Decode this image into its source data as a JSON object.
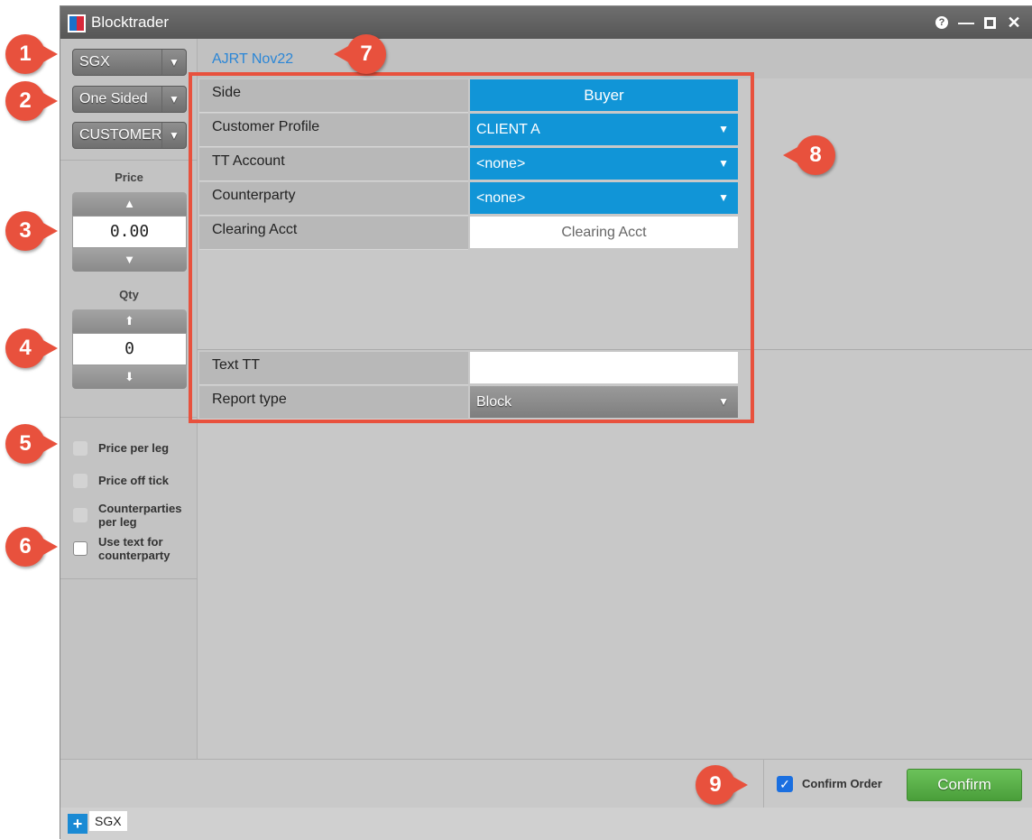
{
  "window": {
    "title": "Blocktrader",
    "controls": {
      "help": "?",
      "minimize": "—",
      "maximize": "",
      "close": "✕"
    }
  },
  "sidebar": {
    "exchange_select": "SGX",
    "side_mode_select": "One Sided",
    "account_type_select": "CUSTOMER",
    "price": {
      "label": "Price",
      "value": "0.00",
      "up": "▲",
      "down": "▼"
    },
    "qty": {
      "label": "Qty",
      "value": "0",
      "up": "🡩",
      "down": "🡫"
    },
    "options": [
      {
        "label": "Price per leg",
        "checked": false
      },
      {
        "label": "Price off tick",
        "checked": false
      },
      {
        "label": "Counterparties per leg",
        "checked": false
      },
      {
        "label": "Use text for counterparty",
        "checked": false
      }
    ]
  },
  "main": {
    "contract_title": "AJRT Nov22",
    "form": {
      "side": {
        "label": "Side",
        "value": "Buyer"
      },
      "customer_profile": {
        "label": "Customer Profile",
        "value": "CLIENT A"
      },
      "tt_account": {
        "label": "TT Account",
        "value": "<none>"
      },
      "counterparty": {
        "label": "Counterparty",
        "value": "<none>"
      },
      "clearing_acct": {
        "label": "Clearing Acct",
        "placeholder": "Clearing Acct"
      },
      "text_tt": {
        "label": "Text TT",
        "value": ""
      },
      "report_type": {
        "label": "Report type",
        "value": "Block"
      }
    }
  },
  "footer": {
    "confirm_order_label": "Confirm Order",
    "confirm_order_checked": true,
    "confirm_button": "Confirm",
    "add_tab": "+",
    "tab_label": "SGX"
  },
  "callouts": [
    "1",
    "2",
    "3",
    "4",
    "5",
    "6",
    "7",
    "8",
    "9"
  ],
  "colors": {
    "accent_blue": "#1195d7",
    "link_blue": "#2b86d6",
    "callout_red": "#e8513d",
    "confirm_green": "#5cb04a"
  }
}
